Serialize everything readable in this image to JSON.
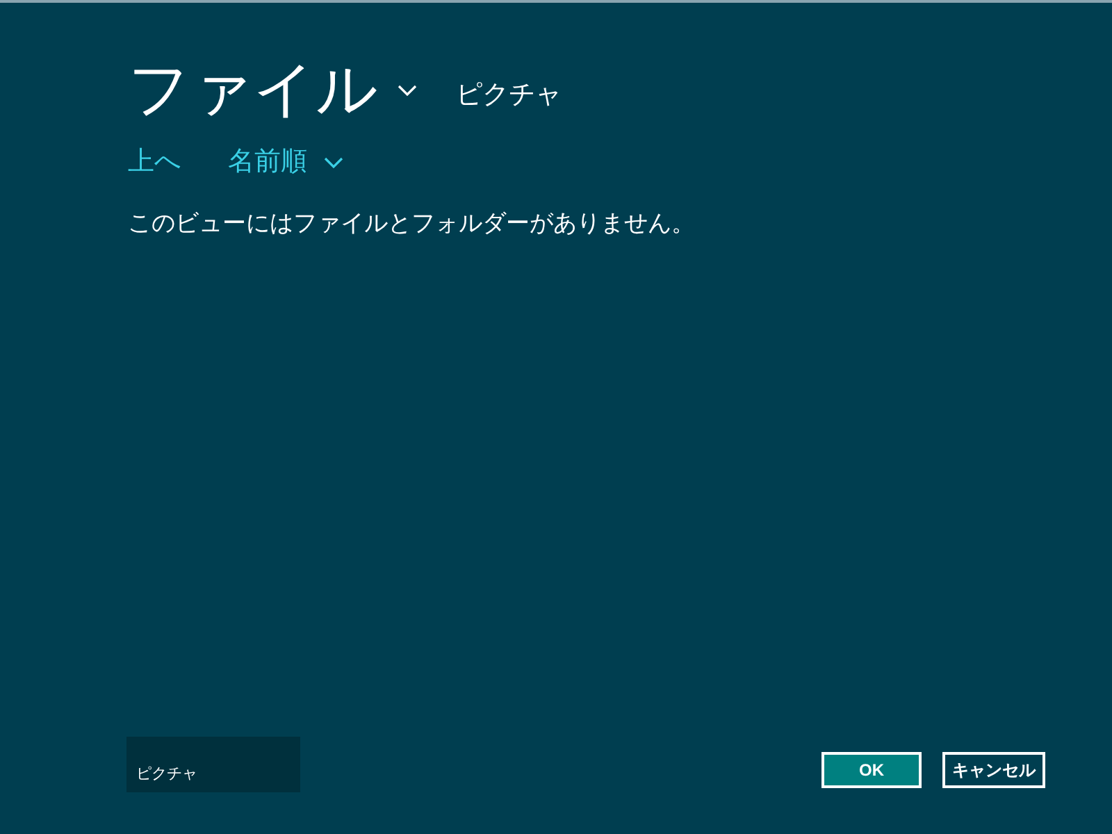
{
  "header": {
    "title": "ファイル",
    "location": "ピクチャ"
  },
  "commands": [
    {
      "label": "上へ",
      "kind": "link"
    },
    {
      "label": "名前順",
      "kind": "dropdown"
    }
  ],
  "message": "このビューにはファイルとフォルダーがありません。",
  "basket": {
    "label": "ピクチャ"
  },
  "buttons": [
    {
      "label": "OK",
      "kind": "primary"
    },
    {
      "label": "キャンセル",
      "kind": "secondary"
    }
  ]
}
